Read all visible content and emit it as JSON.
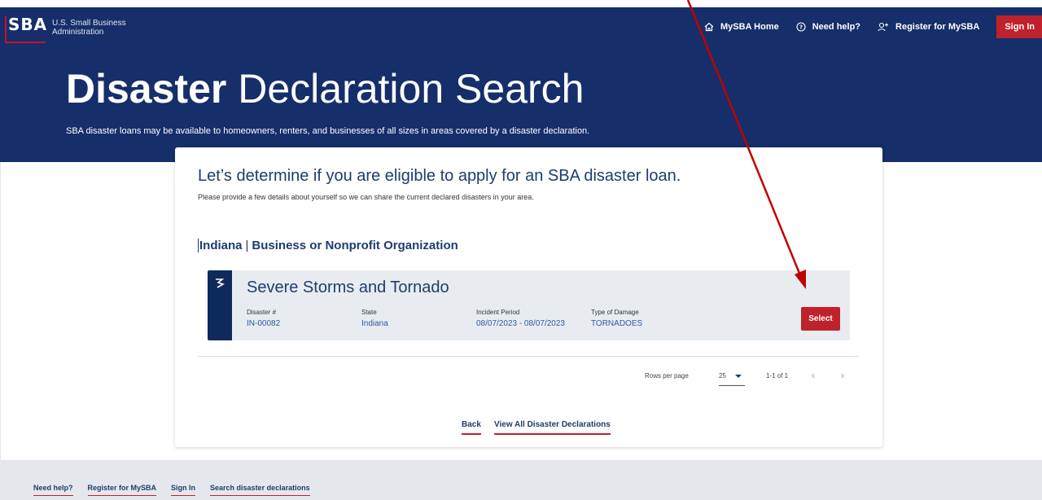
{
  "header": {
    "logo_text": "SBA",
    "org_name": "U.S. Small Business Administration",
    "nav": [
      {
        "label": "MySBA Home",
        "icon": "home-icon"
      },
      {
        "label": "Need help?",
        "icon": "help-circle-icon"
      },
      {
        "label": "Register for MySBA",
        "icon": "add-user-icon"
      }
    ],
    "sign_in_label": "Sign In"
  },
  "hero": {
    "title_bold": "Disaster",
    "title_light": "Declaration Search",
    "subtitle": "SBA disaster loans may be available to homeowners, renters, and businesses of all sizes in areas covered by a disaster declaration."
  },
  "card": {
    "title": "Let’s determine if you are eligible to apply for an SBA disaster loan.",
    "subtitle": "Please provide a few details about yourself so we can share the current declared disasters in your area.",
    "filter_state": "Indiana",
    "filter_separator": "|",
    "filter_type": "Business or Nonprofit Organization",
    "disaster": {
      "title": "Severe Storms and Tornado",
      "icon": "sba-mark-icon",
      "fields": [
        {
          "label": "Disaster #",
          "value": "IN-00082"
        },
        {
          "label": "State",
          "value": "Indiana"
        },
        {
          "label": "Incident Period",
          "value": "08/07/2023 - 08/07/2023"
        },
        {
          "label": "Type of Damage",
          "value": "TORNADOES"
        }
      ],
      "select_label": "Select"
    },
    "pagination": {
      "rows_per_page_label": "Rows per page",
      "rows_per_page_value": "25",
      "range_label": "1-1 of 1",
      "prev_icon": "chevron-left-icon",
      "next_icon": "chevron-right-icon"
    },
    "links": {
      "back": "Back",
      "view_all": "View All Disaster Declarations"
    }
  },
  "footer": {
    "links": [
      "Need help?",
      "Register for MySBA",
      "Sign In",
      "Search disaster declarations"
    ]
  },
  "colors": {
    "navy": "#162e6a",
    "brand_red": "#c0222c",
    "annotation_arrow": "#c00000"
  }
}
